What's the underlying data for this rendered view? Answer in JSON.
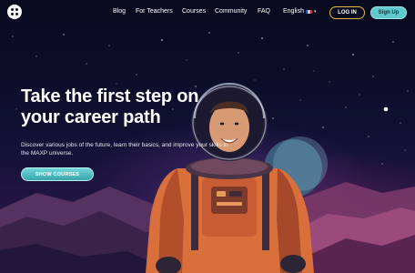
{
  "nav": {
    "links": [
      {
        "label": "Blog"
      },
      {
        "label": "For Teachers"
      },
      {
        "label": "Courses"
      },
      {
        "label": "Community"
      },
      {
        "label": "FAQ"
      }
    ],
    "language": "English",
    "login_label": "LOG IN",
    "signup_label": "Sign Up"
  },
  "hero": {
    "headline": "Take the first step on your career path",
    "subtext": "Discover various jobs of the future, learn their basics, and improve your skills in the MAXP universe.",
    "cta_label": "SHOW COURSES"
  },
  "colors": {
    "accent_teal": "#5fc9ce",
    "login_border": "#e3b93a",
    "sky_dark": "#0b0a24"
  }
}
